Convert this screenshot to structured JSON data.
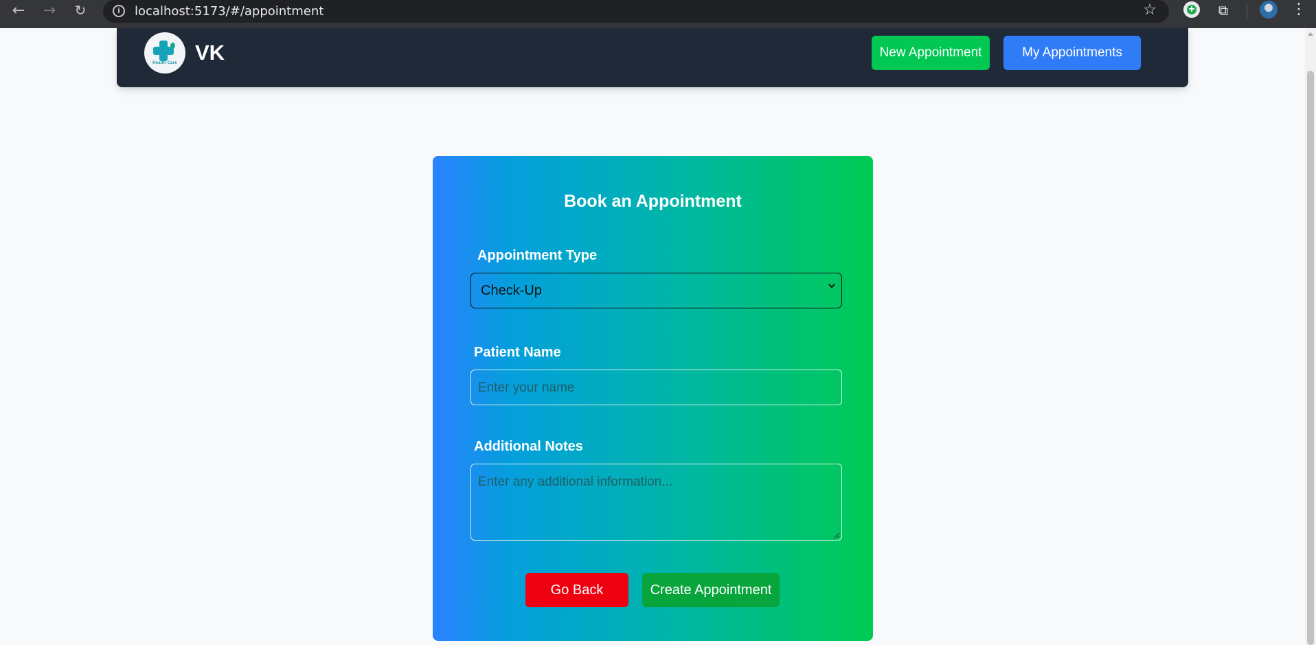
{
  "browser": {
    "url": "localhost:5173/#/appointment",
    "back_icon": "←",
    "forward_icon": "→",
    "reload_icon": "↻",
    "star_icon": "☆",
    "menu_icon": "⋮"
  },
  "header": {
    "brand": "VK",
    "logo_text": "Health Care",
    "new_appointment_label": "New Appointment",
    "my_appointments_label": "My Appointments"
  },
  "form": {
    "title": "Book an Appointment",
    "appointment_type_label": "Appointment Type",
    "appointment_type_value": "Check-Up",
    "patient_name_label": "Patient Name",
    "patient_name_placeholder": "Enter your name",
    "notes_label": "Additional Notes",
    "notes_placeholder": "Enter any additional information...",
    "go_back_label": "Go Back",
    "create_label": "Create Appointment"
  },
  "colors": {
    "header_bg": "#1f2937",
    "new_button": "#00c853",
    "my_button": "#2f7cf6",
    "go_back": "#ee0010",
    "create": "#07a53c",
    "gradient_start": "#2b82ff",
    "gradient_end": "#00cb52"
  }
}
